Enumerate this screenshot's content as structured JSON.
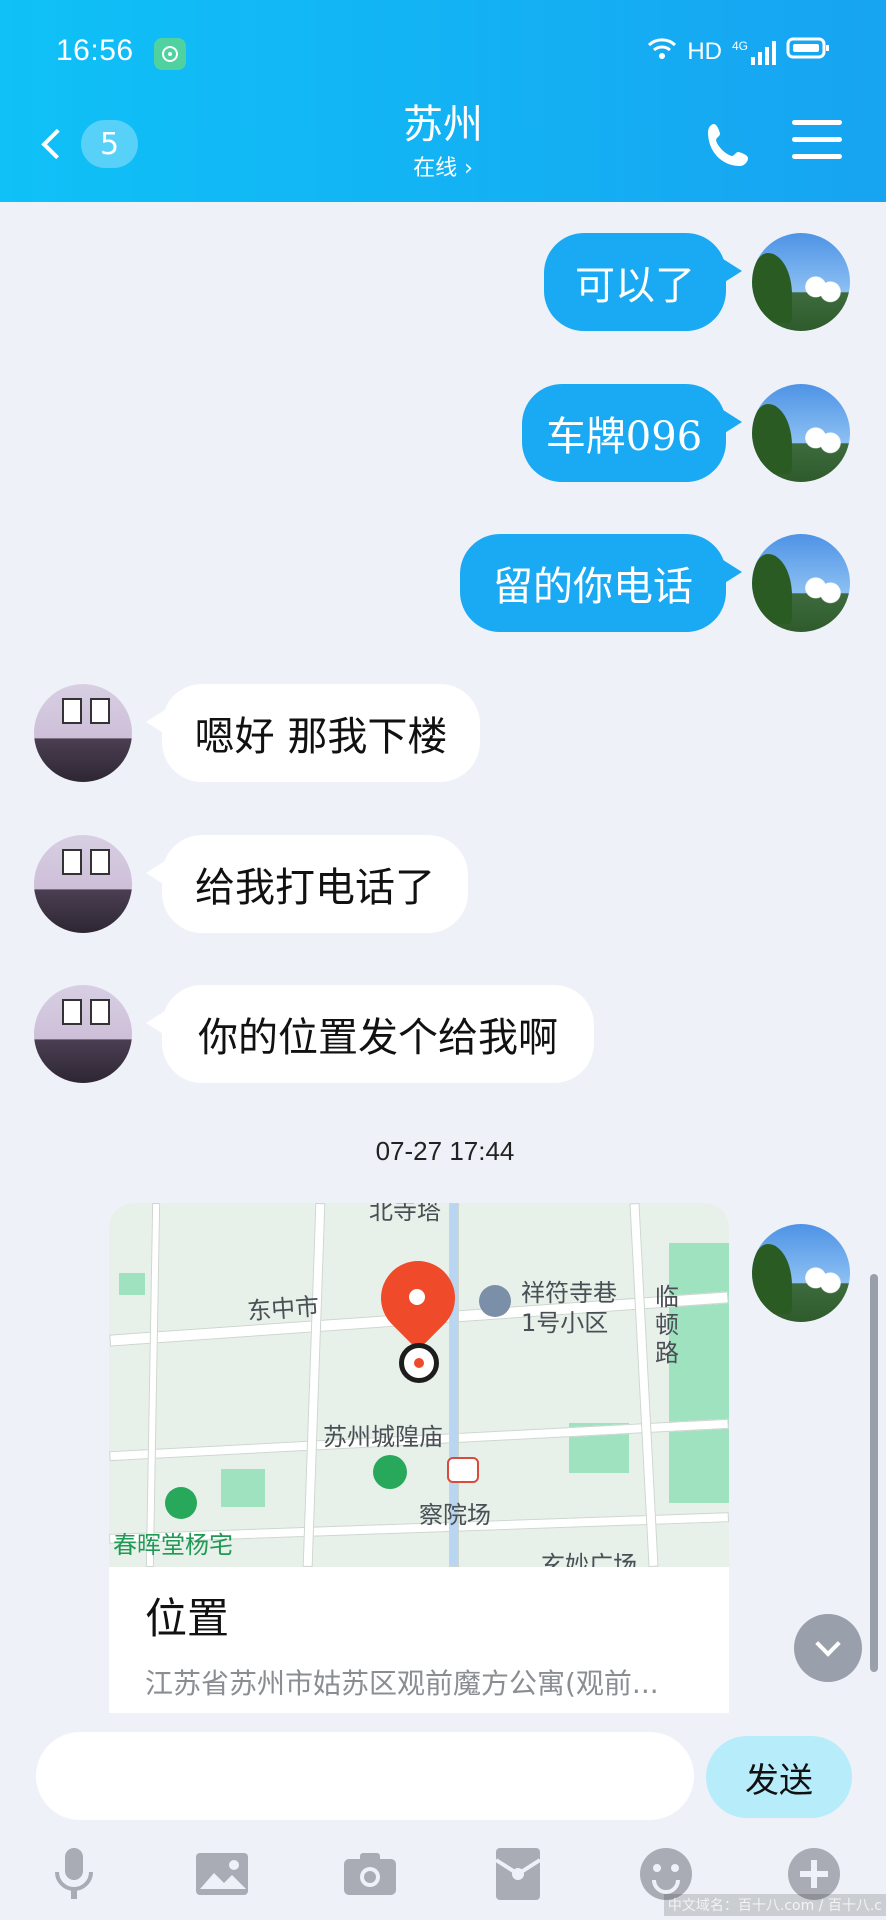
{
  "status_bar": {
    "time": "16:56",
    "network": "HD",
    "signal": "4G"
  },
  "header": {
    "back_count": "5",
    "title": "苏州",
    "subtitle": "在线 ›"
  },
  "messages": [
    {
      "from": "me",
      "text": "可以了"
    },
    {
      "from": "me",
      "text": "车牌096"
    },
    {
      "from": "me",
      "text": "留的你电话"
    },
    {
      "from": "other",
      "text": "嗯好 那我下楼"
    },
    {
      "from": "other",
      "text": "给我打电话了"
    },
    {
      "from": "other",
      "text": "你的位置发个给我啊"
    }
  ],
  "timestamp": "07-27 17:44",
  "location_card": {
    "map_labels": [
      "东中市",
      "祥符寺巷",
      "1号小区",
      "临",
      "顿",
      "路",
      "苏州城隍庙",
      "察院场",
      "春晖堂杨宅",
      "玄妙广场",
      "北寺塔"
    ],
    "title": "位置",
    "address": "江苏省苏州市姑苏区观前魔方公寓(观前..."
  },
  "composer": {
    "placeholder": "",
    "send_label": "发送"
  },
  "toolbar": {
    "icons": [
      "microphone-icon",
      "image-icon",
      "camera-icon",
      "red-packet-icon",
      "emoji-icon",
      "plus-icon"
    ]
  },
  "watermark": "中文域名：百十八.com / 百十八.c",
  "colors": {
    "header": "#17a4f1",
    "my_bubble": "#1aa9f3",
    "background": "#eef1f7",
    "send_button": "#b7ecfb"
  }
}
